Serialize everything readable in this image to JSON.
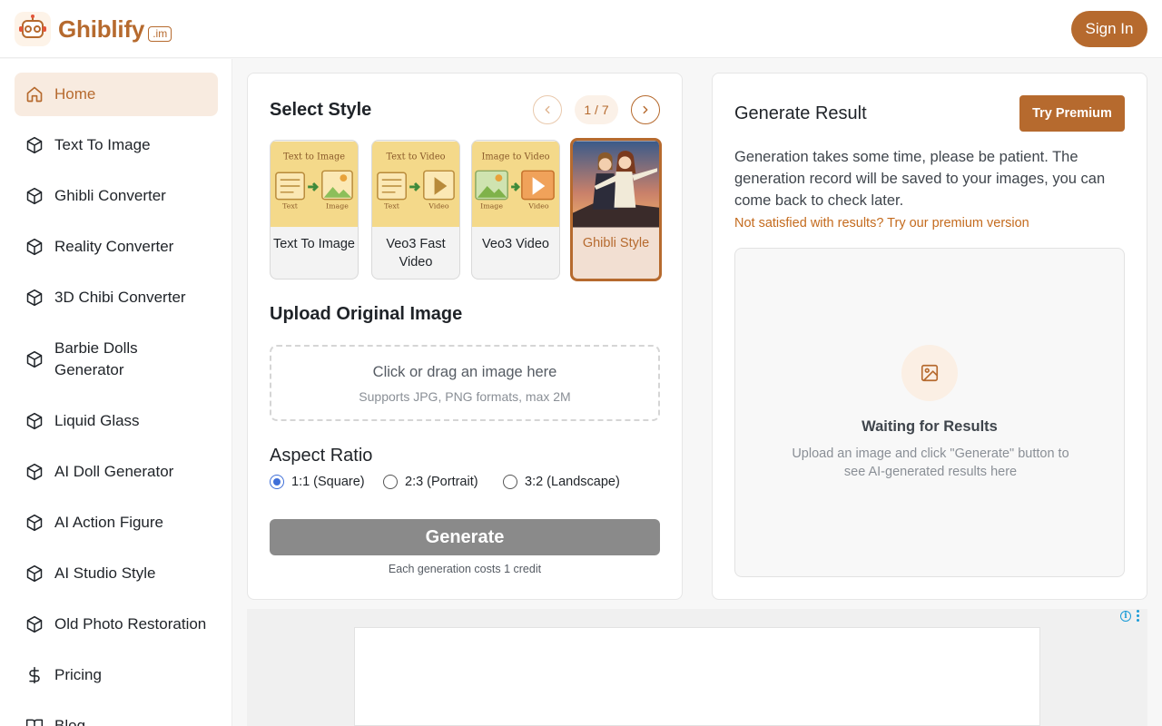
{
  "header": {
    "brand_name": "Ghiblify",
    "brand_suffix": ".im",
    "sign_in_label": "Sign In"
  },
  "sidebar": {
    "items": [
      {
        "label": "Home",
        "icon": "home-icon",
        "active": true
      },
      {
        "label": "Text To Image",
        "icon": "cube-icon"
      },
      {
        "label": "Ghibli Converter",
        "icon": "cube-icon"
      },
      {
        "label": "Reality Converter",
        "icon": "cube-icon"
      },
      {
        "label": "3D Chibi Converter",
        "icon": "cube-icon"
      },
      {
        "label": "Barbie Dolls Generator",
        "icon": "cube-icon"
      },
      {
        "label": "Liquid Glass",
        "icon": "cube-icon"
      },
      {
        "label": "AI Doll Generator",
        "icon": "cube-icon"
      },
      {
        "label": "AI Action Figure",
        "icon": "cube-icon"
      },
      {
        "label": "AI Studio Style",
        "icon": "cube-icon"
      },
      {
        "label": "Old Photo Restoration",
        "icon": "cube-icon"
      },
      {
        "label": "Pricing",
        "icon": "dollar-icon"
      },
      {
        "label": "Blog",
        "icon": "book-icon"
      }
    ]
  },
  "style_panel": {
    "title": "Select Style",
    "page_indicator": "1 / 7",
    "styles": [
      {
        "label": "Text To Image",
        "thumb_caption": "Text to Image",
        "thumb_left": "Text",
        "thumb_right": "Image"
      },
      {
        "label": "Veo3 Fast Video",
        "thumb_caption": "Text to Video",
        "thumb_left": "Text",
        "thumb_right": "Video"
      },
      {
        "label": "Veo3 Video",
        "thumb_caption": "Image to Video",
        "thumb_left": "Image",
        "thumb_right": "Video"
      },
      {
        "label": "Ghibli Style",
        "selected": true
      }
    ],
    "upload_title": "Upload Original Image",
    "upload_main": "Click or drag an image here",
    "upload_sub": "Supports JPG, PNG formats, max 2M",
    "aspect_title": "Aspect Ratio",
    "aspect_options": [
      {
        "label": "1:1 (Square)",
        "checked": true
      },
      {
        "label": "2:3 (Portrait)",
        "checked": false
      },
      {
        "label": "3:2 (Landscape)",
        "checked": false
      }
    ],
    "generate_label": "Generate",
    "cost_note": "Each generation costs 1 credit"
  },
  "result_panel": {
    "title": "Generate Result",
    "premium_label": "Try Premium",
    "description": "Generation takes some time, please be patient. The generation record will be saved to your images, you can come back to check later.",
    "premium_link": "Not satisfied with results? Try our premium version",
    "waiting_title": "Waiting for Results",
    "waiting_sub": "Upload an image and click \"Generate\" button to see AI-generated results here"
  },
  "ad": {
    "info_glyph": "i"
  },
  "colors": {
    "accent": "#b66a2e",
    "accent_light": "#f8ebe0",
    "radio_blue": "#3f6fd8",
    "disabled_button": "#8a8a8a"
  }
}
